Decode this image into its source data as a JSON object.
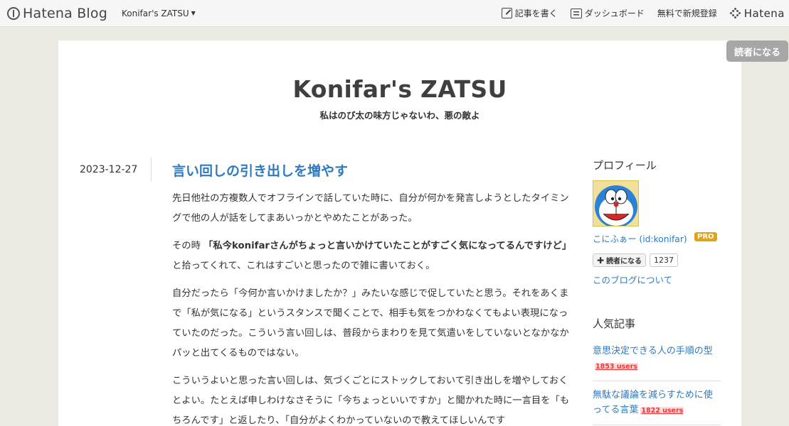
{
  "topbar": {
    "logo_text": "Hatena Blog",
    "blog_name": "Konifar's ZATSU",
    "write_label": "記事を書く",
    "dashboard_label": "ダッシュボード",
    "signup_label": "無料で新規登録",
    "hatena_label": "Hatena"
  },
  "floating_subscribe": "読者になる",
  "blog": {
    "title": "Konifar's ZATSU",
    "description": "私はのび太の味方じゃないわ、悪の敵よ"
  },
  "entry": {
    "date": "2023-12-27",
    "title": "言い回しの引き出しを増やす",
    "p1": "先日他社の方複数人でオフラインで話していた時に、自分が何かを発言しようとしたタイミングで他の人が話をしてまあいっかとやめたことがあった。",
    "p2_pre": "その時 ",
    "p2_quote": "「私今konifarさんがちょっと言いかけていたことがすごく気になってるんですけど」",
    "p2_post": "と拾ってくれて、これはすごいと思ったので雑に書いておく。",
    "p3": "自分だったら「今何か言いかけましたか？」みたいな感じで促していたと思う。それをあくまで「私が気になる」というスタンスで聞くことで、相手も気をつかわなくてもよい表現になっていたのだった。こういう言い回しは、普段からまわりを見て気遣いをしていないとなかなかパッと出てくるものではない。",
    "p4": "こういうよいと思った言い回しは、気づくごとにストックしておいて引き出しを増やしておくとよい。たとえば申しわけなさそうに「今ちょっといいですか」と聞かれた時に一言目を「もちろんです」と返したり、「自分がよくわかっていないので教えてほしいんです"
  },
  "sidebar": {
    "profile_heading": "プロフィール",
    "profile_name": "こにふぁー (id:konifar)",
    "pro_badge": "PRO",
    "subscribe_label": "読者になる",
    "subscriber_count": "1237",
    "about_link": "このブログについて",
    "popular_heading": "人気記事",
    "popular": [
      {
        "title": "意思決定できる人の手順の型",
        "users": "1853 users"
      },
      {
        "title": "無駄な議論を減らすために使ってる言葉",
        "users": "1822 users"
      }
    ]
  },
  "colors": {
    "link": "#2f7abf",
    "background": "#ebeae3",
    "pro_badge": "#e2a417",
    "bookmark_users": "#e63a3a"
  }
}
